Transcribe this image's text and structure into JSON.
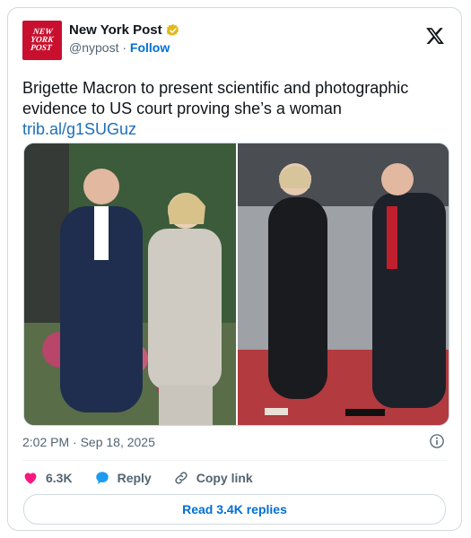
{
  "account": {
    "display_name": "New York Post",
    "handle": "@nypost",
    "separator": "·",
    "follow_label": "Follow",
    "avatar_lines": [
      "NEW",
      "YORK",
      "POST"
    ]
  },
  "tweet": {
    "text": "Brigette Macron to present scientific and photographic evidence to US court proving she’s a woman",
    "link": "trib.al/g1SUGuz"
  },
  "media": {
    "left_photo": "photo-couple-garden",
    "right_photo": "photo-couple-red-carpet"
  },
  "meta": {
    "timestamp": "2:02 PM · Sep 18, 2025"
  },
  "actions": {
    "likes": "6.3K",
    "reply_label": "Reply",
    "copy_link_label": "Copy link"
  },
  "read_replies_label": "Read 3.4K replies",
  "colors": {
    "like": "#f91880",
    "reply": "#1d9bf0",
    "link": "#006fd6",
    "avatar": "#c8102e",
    "verified": "#e2b719"
  }
}
